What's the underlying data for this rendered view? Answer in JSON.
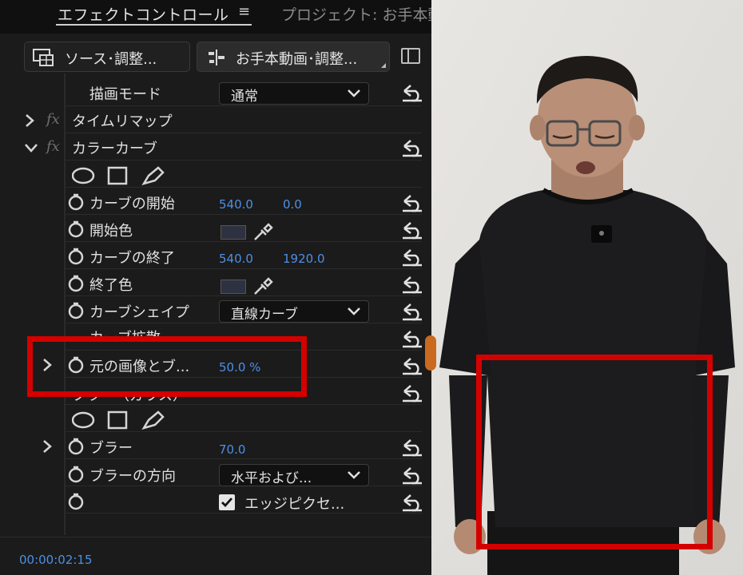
{
  "tabs": {
    "effect_controls": "エフェクトコントロール",
    "menu_icon": "≡",
    "project": "プロジェクト: お手本動"
  },
  "header": {
    "source_label": "ソース･調整...",
    "clip_label": "お手本動画･調整..."
  },
  "rows": {
    "draw_mode": {
      "label": "描画モード",
      "value": "通常"
    },
    "time_remap": {
      "label": "タイムリマップ"
    },
    "color_curve": {
      "label": "カラーカーブ"
    },
    "curve_start": {
      "label": "カーブの開始",
      "x": "540.0",
      "y": "0.0"
    },
    "start_color": {
      "label": "開始色"
    },
    "curve_end": {
      "label": "カーブの終了",
      "x": "540.0",
      "y": "1920.0"
    },
    "end_color": {
      "label": "終了色"
    },
    "curve_shape": {
      "label": "カーブシェイプ",
      "value": "直線カーブ"
    },
    "curve_scatter": {
      "label": "カーブ拡散"
    },
    "blend_original": {
      "label": "元の画像とブ...",
      "value": "50.0 %"
    },
    "blur_effect": {
      "label": "ブラー（ガウス）"
    },
    "blur": {
      "label": "ブラー",
      "value": "70.0"
    },
    "blur_direction": {
      "label": "ブラーの方向",
      "value": "水平および..."
    },
    "edge_pixels": {
      "label": "エッジピクセ..."
    }
  },
  "timecode": "00:00:02:15",
  "colors": {
    "accent_blue": "#4d8fe6",
    "highlight_red": "#d40000",
    "panel_bg": "#1b1b1b"
  }
}
